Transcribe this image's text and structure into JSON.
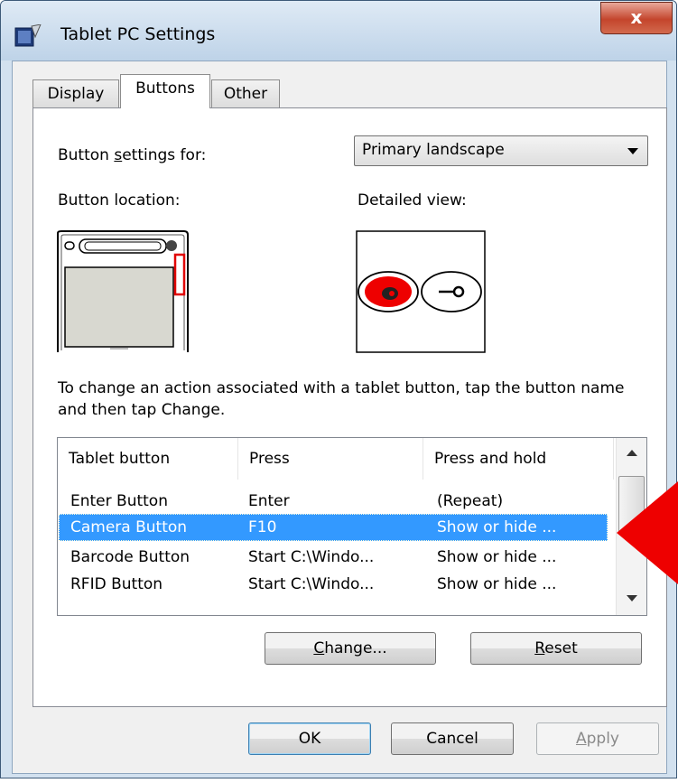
{
  "window": {
    "title": "Tablet PC Settings",
    "close_glyph": "x"
  },
  "tabs": [
    {
      "label": "Display"
    },
    {
      "label": "Buttons",
      "active": true
    },
    {
      "label": "Other"
    }
  ],
  "settings": {
    "button_settings_for_label_pre": "Button ",
    "button_settings_for_label_mnemonic": "s",
    "button_settings_for_label_post": "ettings for:",
    "selected_orientation": "Primary landscape",
    "button_location_label": "Button location:",
    "detailed_view_label": "Detailed view:",
    "instructions": "To change an action associated with a tablet button, tap the button name and then tap Change."
  },
  "table": {
    "columns": [
      "Tablet button",
      "Press",
      "Press and hold"
    ],
    "rows": [
      {
        "button": "Enter Button",
        "press": "Enter",
        "hold": "(Repeat)"
      },
      {
        "button": "Camera Button",
        "press": "F10",
        "hold": "Show or hide ...",
        "selected": true
      },
      {
        "button": "Barcode Button",
        "press": "Start C:\\Windo...",
        "hold": "Show or hide ..."
      },
      {
        "button": "RFID Button",
        "press": "Start C:\\Windo...",
        "hold": "Show or hide ..."
      }
    ]
  },
  "buttons": {
    "change_mnemonic": "C",
    "change_rest": "hange...",
    "reset_mnemonic": "R",
    "reset_rest": "eset",
    "ok": "OK",
    "cancel": "Cancel",
    "apply_mnemonic": "A",
    "apply_rest": "pply"
  },
  "colors": {
    "selection": "#3399ff",
    "highlight_red": "#ee0000",
    "title_blue": "#bed3e8"
  }
}
